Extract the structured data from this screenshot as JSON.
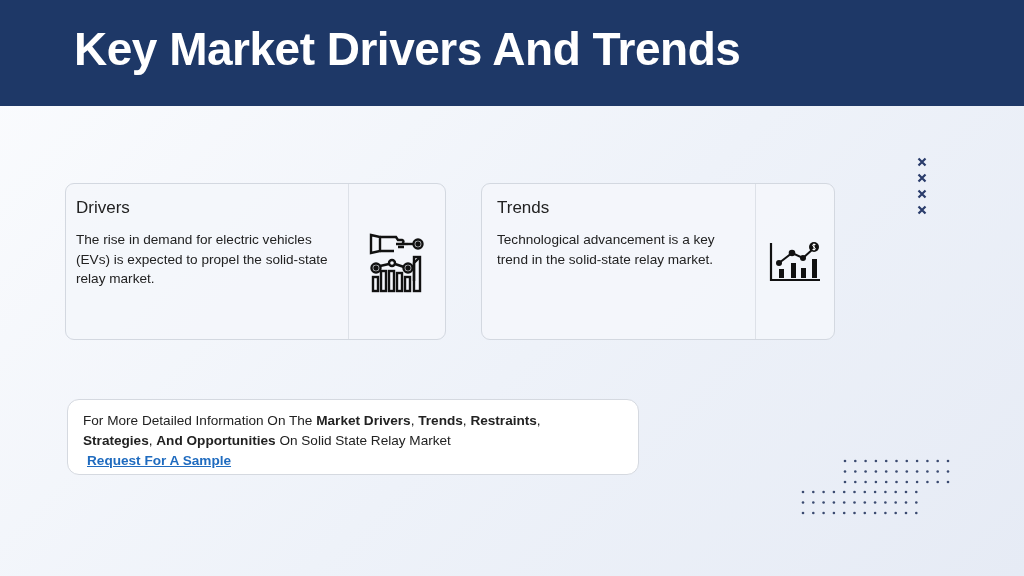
{
  "title": "Key Market Drivers And Trends",
  "cards": [
    {
      "heading": "Drivers",
      "text": "The rise in demand for electric vehicles (EVs) is expected to propel the solid-state relay market.",
      "kind": "drivers"
    },
    {
      "heading": "Trends",
      "text": "Technological advancement is a key trend in the solid-state relay market.",
      "kind": "trends"
    }
  ],
  "info": {
    "text": "For More Detailed Information On The **Market Drivers**, **Trends**, **Restraints**, **Strategies**, **And Opportunities** On Solid State Relay Market",
    "link": "Request For A Sample"
  }
}
